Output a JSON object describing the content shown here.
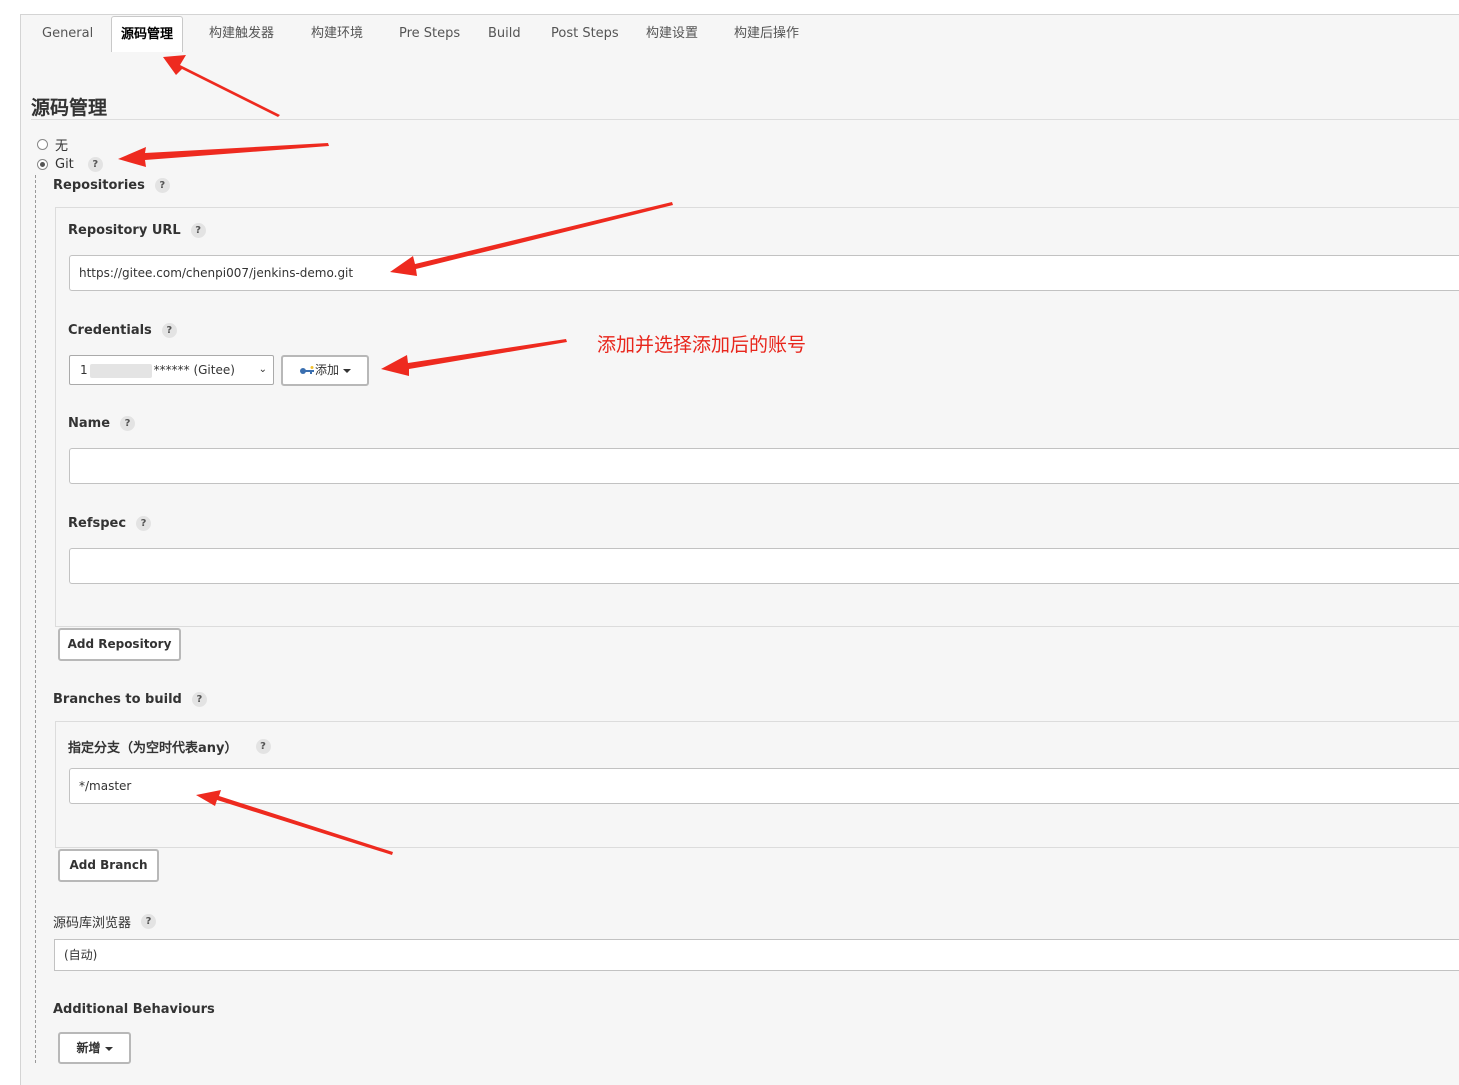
{
  "tabs": [
    {
      "label": "General",
      "active": false
    },
    {
      "label": "源码管理",
      "active": true
    },
    {
      "label": "构建触发器",
      "active": false
    },
    {
      "label": "构建环境",
      "active": false
    },
    {
      "label": "Pre Steps",
      "active": false
    },
    {
      "label": "Build",
      "active": false
    },
    {
      "label": "Post Steps",
      "active": false
    },
    {
      "label": "构建设置",
      "active": false
    },
    {
      "label": "构建后操作",
      "active": false
    }
  ],
  "section_title": "源码管理",
  "scm_options": [
    {
      "label": "无",
      "checked": false
    },
    {
      "label": "Git",
      "checked": true
    }
  ],
  "help_glyph": "?",
  "repositories": {
    "label": "Repositories",
    "repo_url_label": "Repository URL",
    "repo_url_value": "https://gitee.com/chenpi007/jenkins-demo.git",
    "credentials_label": "Credentials",
    "credentials_prefix": "1",
    "credentials_suffix": "****** (Gitee)",
    "add_label": "添加",
    "name_label": "Name",
    "name_value": "",
    "refspec_label": "Refspec",
    "refspec_value": "",
    "add_repository_label": "Add Repository"
  },
  "branches": {
    "label": "Branches to build",
    "branch_specifier_label": "指定分支（为空时代表any）",
    "branch_specifier_value": "*/master",
    "add_branch_label": "Add Branch"
  },
  "repo_browser": {
    "label": "源码库浏览器",
    "value": "(自动)"
  },
  "additional_behaviours": {
    "label": "Additional Behaviours",
    "add_label": "新增"
  },
  "annotation_text": "添加并选择添加后的账号",
  "colors": {
    "annotation": "#e8261c",
    "panel_bg": "#f6f6f6"
  }
}
